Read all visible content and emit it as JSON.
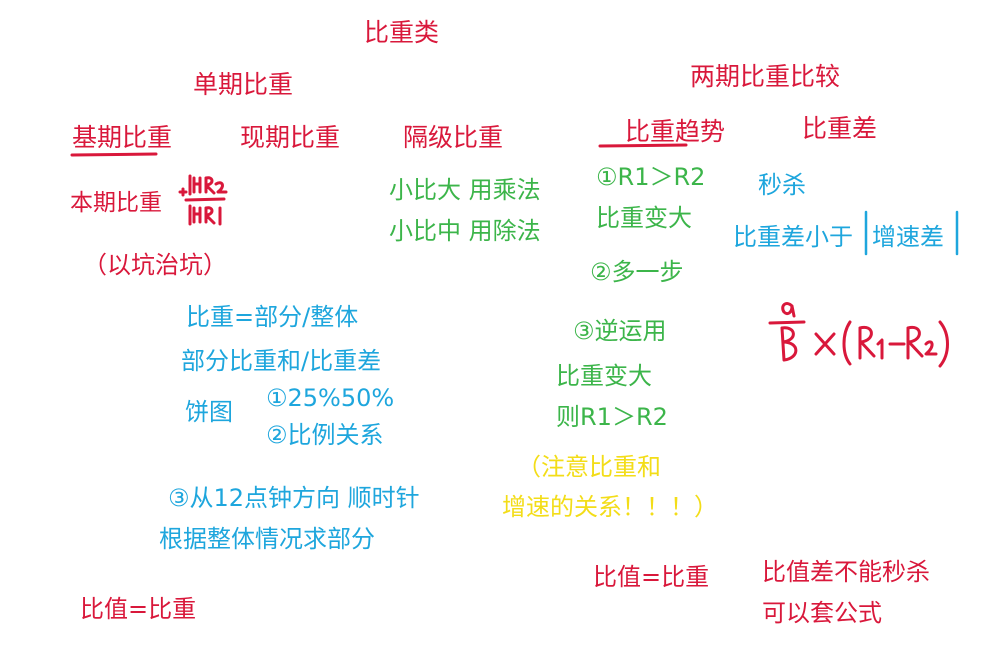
{
  "colors": {
    "red": "#d9183b",
    "blue": "#1ea6dd",
    "green": "#3cb54a",
    "yellow": "#f3dd18"
  },
  "title": "比重类",
  "single": {
    "heading": "单期比重",
    "base": "基期比重",
    "current": "现期比重",
    "interval": "隔级比重",
    "base_formula": "本期比重",
    "note": "（以坑治坑）"
  },
  "green_left": {
    "line1": "小比大 用乘法",
    "line2": "小比中 用除法"
  },
  "blue_left": {
    "def": "比重=部分/整体",
    "sum": "部分比重和/比重差",
    "pie": "饼图",
    "pie1": "①25%50%",
    "pie2": "②比例关系",
    "pie3": "③从12点钟方向 顺时针",
    "pie4": "根据整体情况求部分"
  },
  "ratio_left": "比值=比重",
  "two_period": {
    "heading": "两期比重比较",
    "trend": "比重趋势",
    "diff": "比重差",
    "t1": "①R1＞R2",
    "t2": "比重变大",
    "t3": "②多一步",
    "t4": "③逆运用",
    "t5": "比重变大",
    "t6": "则R1＞R2"
  },
  "yellow_note": {
    "line1": "（注意比重和",
    "line2": "增速的关系！！！）"
  },
  "diff_blue": {
    "line1": "秒杀",
    "line2": "比重差小于",
    "line3": "增速差"
  },
  "ratio_right": "比值=比重",
  "ratio_diff": {
    "line1": "比值差不能秒杀",
    "line2": "可以套公式"
  }
}
